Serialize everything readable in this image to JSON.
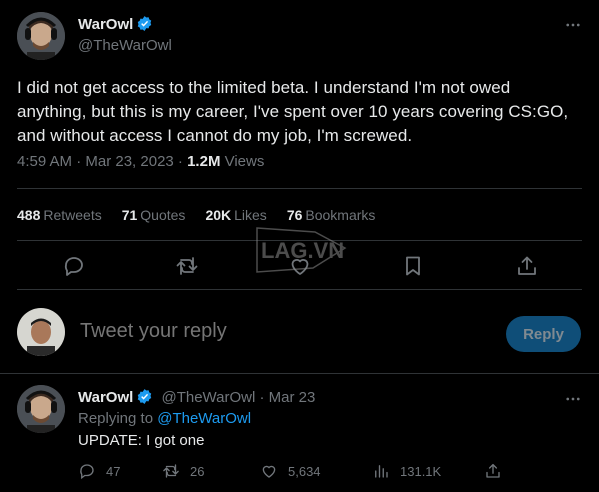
{
  "author": {
    "name": "WarOwl",
    "handle": "@TheWarOwl"
  },
  "tweet": {
    "text": "I did not get access to the limited beta.  I understand I'm not owed anything, but this is my career, I've spent over 10 years covering CS:GO, and without access I cannot do my job, I'm screwed.",
    "time": "4:59 AM · Mar 23, 2023 · ",
    "views_count": "1.2M",
    "views_label": " Views"
  },
  "stats": {
    "retweets_count": "488",
    "retweets_label": "Retweets",
    "quotes_count": "71",
    "quotes_label": "Quotes",
    "likes_count": "20K",
    "likes_label": "Likes",
    "bookmarks_count": "76",
    "bookmarks_label": "Bookmarks"
  },
  "composer": {
    "placeholder": "Tweet your reply",
    "button_label": "Reply"
  },
  "reply": {
    "name": "WarOwl",
    "handle": "@TheWarOwl",
    "date": " · Mar 23",
    "replying_prefix": "Replying to ",
    "replying_to": "@TheWarOwl",
    "text": "UPDATE: I got one",
    "replies": "47",
    "retweets": "26",
    "likes": "5,634",
    "views": "131.1K"
  },
  "watermark": {
    "text": "LAG.VN"
  },
  "colors": {
    "background": "#000000",
    "text": "#e7e9ea",
    "muted": "#71767b",
    "accent": "#1d9bf0",
    "divider": "#2f3336",
    "reply_button": "#0f4e78"
  },
  "icons": [
    "verified-badge-icon",
    "more-icon",
    "reply-icon",
    "retweet-icon",
    "like-icon",
    "bookmark-icon",
    "share-icon",
    "views-icon"
  ]
}
